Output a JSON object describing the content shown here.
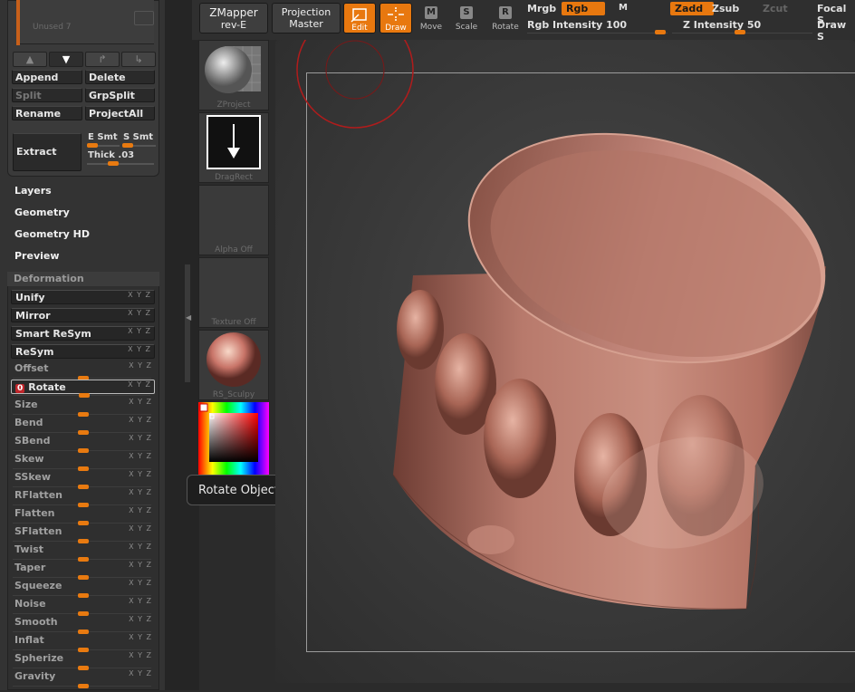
{
  "subtool": {
    "unused_label": "Unused 7"
  },
  "subtool_buttons": {
    "append": "Append",
    "delete": "Delete",
    "split": "Split",
    "grpsplit": "GrpSplit",
    "rename": "Rename",
    "projectall": "ProjectAll",
    "extract": "Extract",
    "e_smt": "E Smt",
    "s_smt": "S Smt",
    "thick": "Thick .03"
  },
  "menus": [
    "Layers",
    "Geometry",
    "Geometry HD",
    "Preview"
  ],
  "deformation": {
    "title": "Deformation",
    "rows": [
      {
        "label": "Unify",
        "axes": "X Y Z"
      },
      {
        "label": "Mirror",
        "axes": "X Y Z"
      },
      {
        "label": "Smart ReSym",
        "axes": "X Y Z"
      },
      {
        "label": "ReSym",
        "axes": "X Y Z"
      },
      {
        "label": "Offset",
        "axes": "X Y Z"
      },
      {
        "label": "Rotate",
        "axes": "X Y Z",
        "badge": "0"
      },
      {
        "label": "Size",
        "axes": "X Y Z"
      },
      {
        "label": "Bend",
        "axes": "X Y Z"
      },
      {
        "label": "SBend",
        "axes": "X Y Z"
      },
      {
        "label": "Skew",
        "axes": "X Y Z"
      },
      {
        "label": "SSkew",
        "axes": "X Y Z"
      },
      {
        "label": "RFlatten",
        "axes": "X Y Z"
      },
      {
        "label": "Flatten",
        "axes": "X Y Z"
      },
      {
        "label": "SFlatten",
        "axes": "X Y Z"
      },
      {
        "label": "Twist",
        "axes": "X Y Z"
      },
      {
        "label": "Taper",
        "axes": "X Y Z"
      },
      {
        "label": "Squeeze",
        "axes": "X Y Z"
      },
      {
        "label": "Noise",
        "axes": "X Y Z"
      },
      {
        "label": "Smooth",
        "axes": "X Y Z"
      },
      {
        "label": "Inflat",
        "axes": "X Y Z"
      },
      {
        "label": "Spherize",
        "axes": "X Y Z"
      },
      {
        "label": "Gravity",
        "axes": "X Y Z"
      }
    ]
  },
  "tiles": [
    "ZProject",
    "DragRect",
    "Alpha Off",
    "Texture Off",
    "RS_Sculpy"
  ],
  "tooltip": "Rotate Object",
  "toolbar": {
    "zmapper_l1": "ZMapper",
    "zmapper_l2": "rev-E",
    "projection_l1": "Projection",
    "projection_l2": "Master",
    "edit": "Edit",
    "draw": "Draw",
    "move": "Move",
    "scale": "Scale",
    "rotate": "Rotate",
    "move_key": "M",
    "scale_key": "S",
    "rotate_key": "R",
    "mrgb": "Mrgb",
    "rgb": "Rgb",
    "m": "M",
    "rgb_intensity": "Rgb Intensity 100",
    "zadd": "Zadd",
    "zsub": "Zsub",
    "zcut": "Zcut",
    "z_intensity": "Z Intensity 50",
    "focal": "Focal S",
    "draw_size": "Draw S"
  },
  "colors": {
    "accent": "#e8780f",
    "panel": "#333333",
    "badge": "#c0262b"
  }
}
